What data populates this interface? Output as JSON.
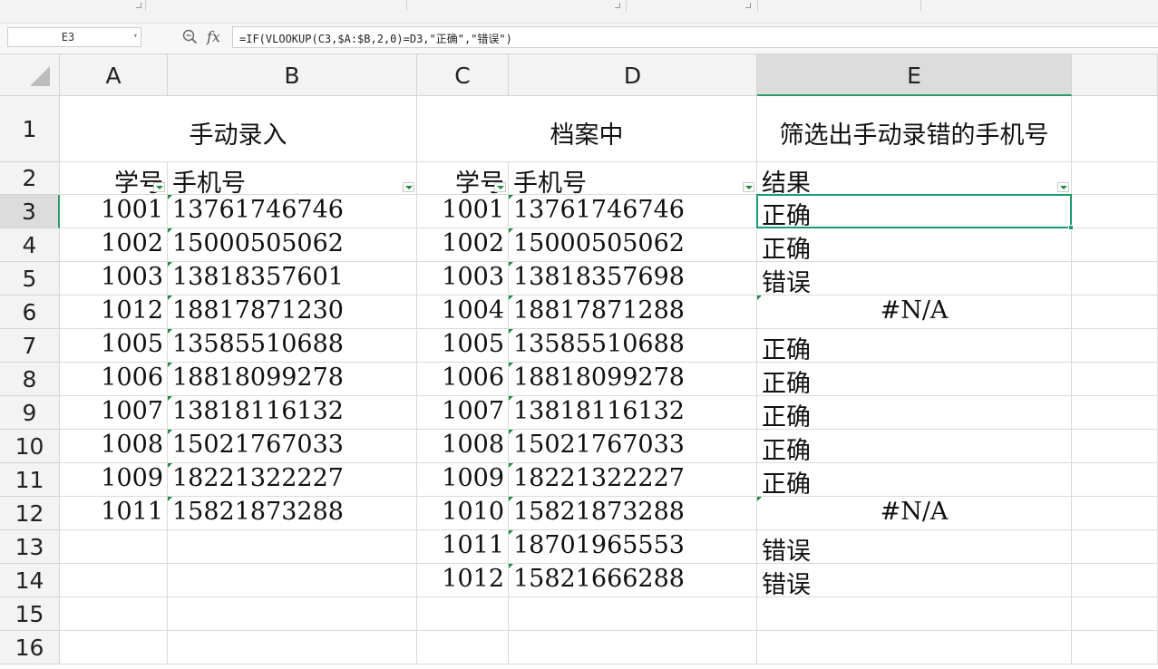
{
  "name_box": "E3",
  "formula": "=IF(VLOOKUP(C3,$A:$B,2,0)=D3,\"正确\",\"错误\")",
  "icons": {
    "zoom": "zoom-formula-icon",
    "fx": "fx"
  },
  "columns": [
    "A",
    "B",
    "C",
    "D",
    "E"
  ],
  "selected_column": "E",
  "rows": [
    "1",
    "2",
    "3",
    "4",
    "5",
    "6",
    "7",
    "8",
    "9",
    "10",
    "11",
    "12",
    "13",
    "14",
    "15",
    "16"
  ],
  "selected_row": "3",
  "headers": {
    "group1": "手动录入",
    "group2": "档案中",
    "group3": "筛选出手动录错的手机号",
    "a": "学号",
    "b": "手机号",
    "c": "学号",
    "d": "手机号",
    "e": "结果"
  },
  "table": [
    [
      "1001",
      "13761746746",
      "1001",
      "13761746746",
      "正确"
    ],
    [
      "1002",
      "15000505062",
      "1002",
      "15000505062",
      "正确"
    ],
    [
      "1003",
      "13818357601",
      "1003",
      "13818357698",
      "错误"
    ],
    [
      "1012",
      "18817871230",
      "1004",
      "18817871288",
      "#N/A"
    ],
    [
      "1005",
      "13585510688",
      "1005",
      "13585510688",
      "正确"
    ],
    [
      "1006",
      "18818099278",
      "1006",
      "18818099278",
      "正确"
    ],
    [
      "1007",
      "13818116132",
      "1007",
      "13818116132",
      "正确"
    ],
    [
      "1008",
      "15021767033",
      "1008",
      "15021767033",
      "正确"
    ],
    [
      "1009",
      "18221322227",
      "1009",
      "18221322227",
      "正确"
    ],
    [
      "1011",
      "15821873288",
      "1010",
      "15821873288",
      "#N/A"
    ],
    [
      "",
      "",
      "1011",
      "18701965553",
      "错误"
    ],
    [
      "",
      "",
      "1012",
      "15821666288",
      "错误"
    ],
    [
      "",
      "",
      "",
      "",
      ""
    ],
    [
      "",
      "",
      "",
      "",
      ""
    ]
  ],
  "colors": {
    "selection": "#1f9b6b",
    "header_bg": "#f3f3f3",
    "grid_line": "#dadada"
  }
}
